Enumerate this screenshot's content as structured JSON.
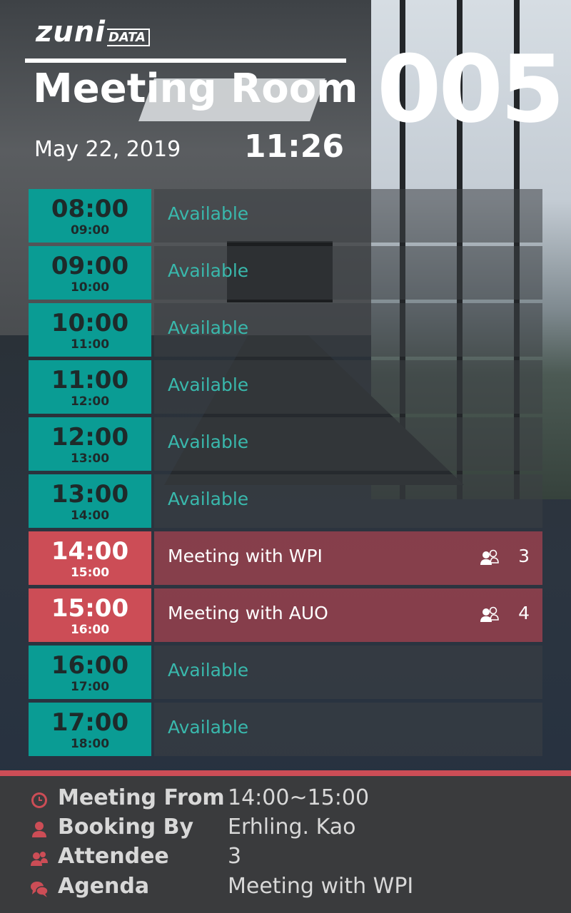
{
  "brand": {
    "logo_main": "zuni",
    "logo_sub": "DATA"
  },
  "header": {
    "room_title": "Meeting Room",
    "room_number": "005",
    "date": "May 22, 2019",
    "clock": "11:26"
  },
  "colors": {
    "available": "#0a9c94",
    "booked": "#cc4d56",
    "panel": "#3a3b3d"
  },
  "slots": [
    {
      "start": "08:00",
      "end": "09:00",
      "label": "Available",
      "status": "available"
    },
    {
      "start": "09:00",
      "end": "10:00",
      "label": "Available",
      "status": "available"
    },
    {
      "start": "10:00",
      "end": "11:00",
      "label": "Available",
      "status": "available"
    },
    {
      "start": "11:00",
      "end": "12:00",
      "label": "Available",
      "status": "available"
    },
    {
      "start": "12:00",
      "end": "13:00",
      "label": "Available",
      "status": "available"
    },
    {
      "start": "13:00",
      "end": "14:00",
      "label": "Available",
      "status": "available"
    },
    {
      "start": "14:00",
      "end": "15:00",
      "label": "Meeting with WPI",
      "status": "booked",
      "attendees": "3"
    },
    {
      "start": "15:00",
      "end": "16:00",
      "label": "Meeting with AUO",
      "status": "booked",
      "attendees": "4"
    },
    {
      "start": "16:00",
      "end": "17:00",
      "label": "Available",
      "status": "available"
    },
    {
      "start": "17:00",
      "end": "18:00",
      "label": "Available",
      "status": "available"
    }
  ],
  "details": {
    "from_label": "Meeting From",
    "from_value": "14:00~15:00",
    "booking_label": "Booking By",
    "booking_value": "Erhling. Kao",
    "attendee_label": "Attendee",
    "attendee_value": "3",
    "agenda_label": "Agenda",
    "agenda_value": "Meeting with WPI",
    "icons": [
      "clock-icon",
      "person-icon",
      "people-icon",
      "chat-icon"
    ]
  }
}
